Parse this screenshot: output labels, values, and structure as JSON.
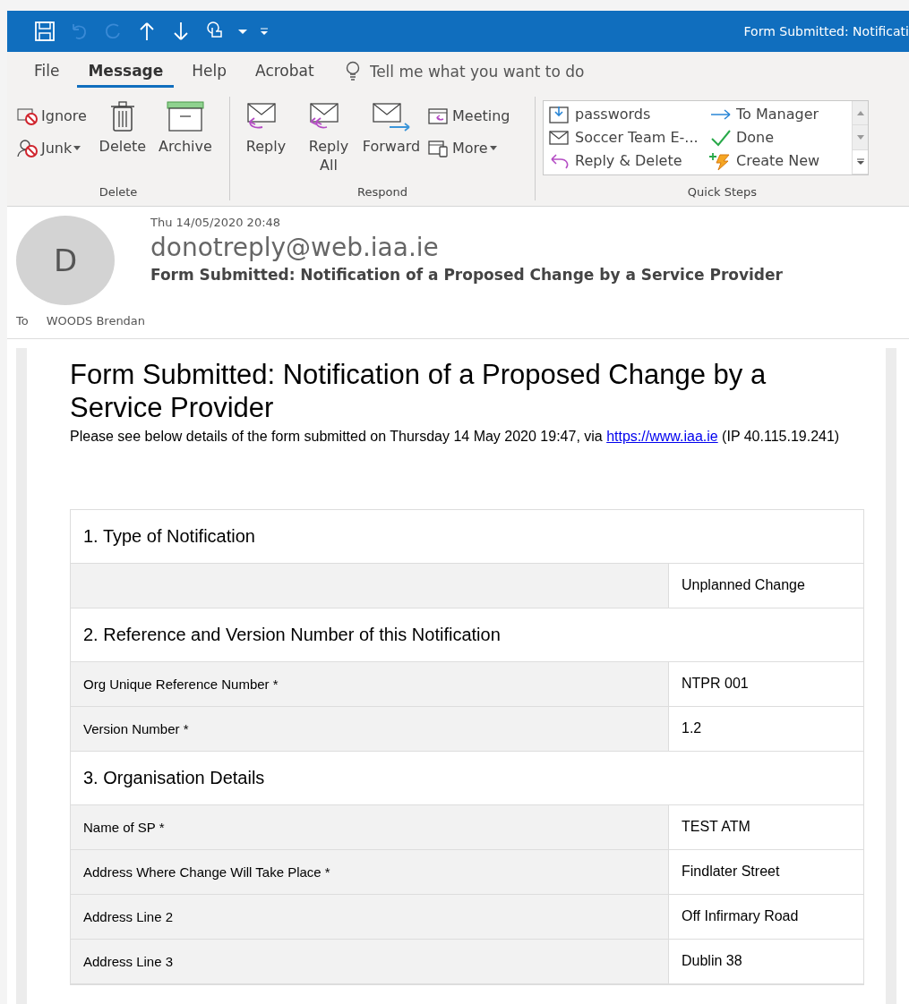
{
  "window": {
    "title": "Form Submitted: Notificati"
  },
  "menu_tabs": [
    {
      "label": "File",
      "selected": false
    },
    {
      "label": "Message",
      "selected": true
    },
    {
      "label": "Help",
      "selected": false
    },
    {
      "label": "Acrobat",
      "selected": false
    }
  ],
  "tell_me": {
    "placeholder": "Tell me what you want to do"
  },
  "ribbon": {
    "delete_group": {
      "label": "Delete",
      "small_buttons": [
        {
          "label": "Ignore",
          "dropdown": false
        },
        {
          "label": "Junk",
          "dropdown": true
        }
      ],
      "large_buttons": [
        {
          "label": "Delete"
        },
        {
          "label": "Archive"
        }
      ]
    },
    "respond_group": {
      "label": "Respond",
      "large_buttons": [
        {
          "label": "Reply"
        },
        {
          "label": "Reply All"
        },
        {
          "label": "Forward"
        }
      ],
      "small_buttons": [
        {
          "label": "Meeting",
          "dropdown": false
        },
        {
          "label": "More",
          "dropdown": true
        }
      ]
    },
    "quick_steps": {
      "label": "Quick Steps",
      "items": [
        {
          "label": "passwords"
        },
        {
          "label": "To Manager"
        },
        {
          "label": "Soccer Team E-..."
        },
        {
          "label": "Done"
        },
        {
          "label": "Reply & Delete"
        },
        {
          "label": "Create New"
        }
      ]
    }
  },
  "message": {
    "avatar_initial": "D",
    "date": "Thu 14/05/2020 20:48",
    "sender": "donotreply@web.iaa.ie",
    "subject": "Form Submitted: Notification of a Proposed Change by a Service Provider",
    "to_label": "To",
    "to": "WOODS Brendan"
  },
  "body": {
    "heading": "Form Submitted: Notification of a Proposed Change by a Service Provider",
    "intro_before": "Please see below details of the form submitted on Thursday 14 May 2020 19:47, via ",
    "link": "https://www.iaa.ie",
    "intro_after": " (IP 40.115.19.241)",
    "rows": [
      {
        "kind": "heading",
        "text": "1. Type of Notification"
      },
      {
        "kind": "field",
        "value": "Unplanned Change"
      },
      {
        "kind": "heading",
        "text": "2. Reference and Version Number of this Notification"
      },
      {
        "kind": "field",
        "label": "Org Unique Reference Number *",
        "value": "NTPR 001"
      },
      {
        "kind": "field",
        "label": "Version Number *",
        "value": "1.2"
      },
      {
        "kind": "heading",
        "text": "3. Organisation Details"
      },
      {
        "kind": "field",
        "label": "Name of SP *",
        "value": "TEST ATM"
      },
      {
        "kind": "field",
        "label": "Address Where Change Will Take Place *",
        "value": "Findlater Street"
      },
      {
        "kind": "field",
        "label": "Address Line 2",
        "value": "Off Infirmary Road"
      },
      {
        "kind": "field",
        "label": "Address Line 3",
        "value": "Dublin 38"
      }
    ]
  }
}
